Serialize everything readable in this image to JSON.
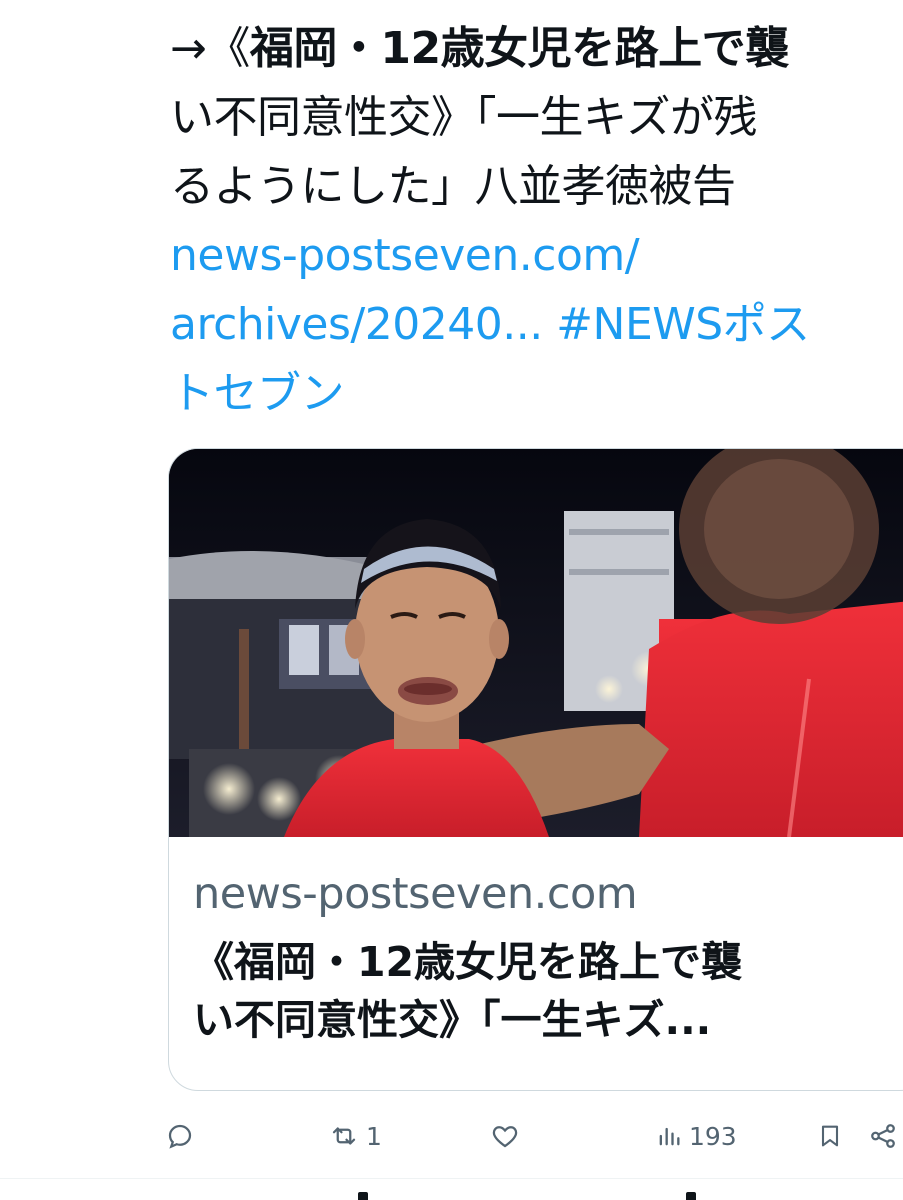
{
  "tweet": {
    "line1_prefix": "→《",
    "line1_bold": "福岡・12歳女児を路上で襲",
    "line2": "い不同意性交》「一生キズが残",
    "line3": "るようにした」八並孝徳被告",
    "link_line1": "news-postseven.com/",
    "link_line2": "archives/20240... #NEWSポス",
    "link_line3": "トセブン"
  },
  "card": {
    "domain": "news-postseven.com",
    "title_line1": "《福岡・12歳女児を路上で襲",
    "title_line2": "い不同意性交》「一生キズ..."
  },
  "actions": {
    "reply": {
      "icon": "reply-icon",
      "count": ""
    },
    "retweet": {
      "icon": "retweet-icon",
      "count": "1"
    },
    "like": {
      "icon": "heart-icon",
      "count": ""
    },
    "views": {
      "icon": "views-icon",
      "count": "193"
    },
    "bookmark": {
      "icon": "bookmark-icon",
      "count": ""
    },
    "share": {
      "icon": "share-icon",
      "count": ""
    }
  },
  "colors": {
    "text": "#0f1419",
    "link": "#1d9bf0",
    "muted": "#536471",
    "border": "#cfd9de"
  }
}
